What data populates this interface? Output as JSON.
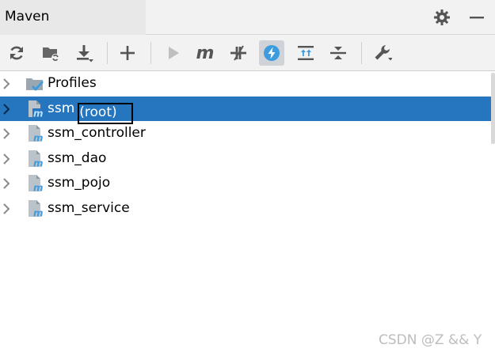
{
  "header": {
    "title": "Maven"
  },
  "tree": {
    "items": [
      {
        "label": "Profiles"
      },
      {
        "label": "ssm",
        "suffix": "(root)",
        "selected": true
      },
      {
        "label": "ssm_controller"
      },
      {
        "label": "ssm_dao"
      },
      {
        "label": "ssm_pojo"
      },
      {
        "label": "ssm_service"
      }
    ]
  },
  "toolbar": {
    "m_label": "m"
  },
  "watermark": "CSDN @Z && Y",
  "colors": {
    "selection": "#2675bf",
    "accent_blue": "#3d9be0",
    "toolbar_bg": "#f2f2f2"
  }
}
